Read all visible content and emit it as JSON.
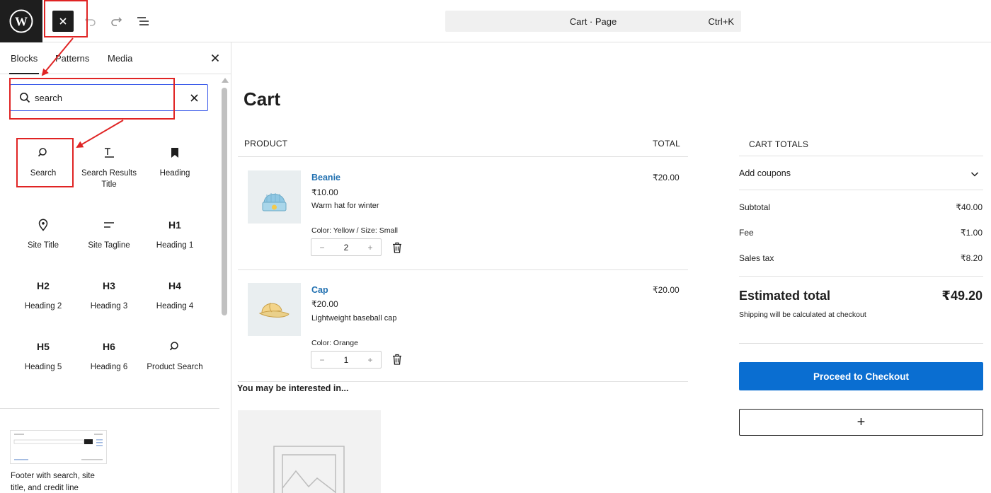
{
  "topbar": {
    "logo_icon": "wordpress-logo",
    "toggle_icon": "close-icon",
    "undo_icon": "undo-icon",
    "redo_icon": "redo-icon",
    "outline_icon": "document-overview-icon",
    "doc_title": "Cart · Page",
    "shortcut": "Ctrl+K"
  },
  "inserter": {
    "tabs": [
      "Blocks",
      "Patterns",
      "Media"
    ],
    "active_tab": "Blocks",
    "search": {
      "value": "search",
      "placeholder": "Search"
    },
    "blocks": [
      {
        "label": "Search",
        "icon": "search-icon"
      },
      {
        "label": "Search Results Title",
        "icon": "title-icon"
      },
      {
        "label": "Heading",
        "icon": "bookmark-icon"
      },
      {
        "label": "Site Title",
        "icon": "map-marker-icon"
      },
      {
        "label": "Site Tagline",
        "icon": "tagline-icon"
      },
      {
        "label": "Heading 1",
        "glyph": "H1"
      },
      {
        "label": "Heading 2",
        "glyph": "H2"
      },
      {
        "label": "Heading 3",
        "glyph": "H3"
      },
      {
        "label": "Heading 4",
        "glyph": "H4"
      },
      {
        "label": "Heading 5",
        "glyph": "H5"
      },
      {
        "label": "Heading 6",
        "glyph": "H6"
      },
      {
        "label": "Product Search",
        "icon": "search-icon"
      }
    ],
    "pattern": {
      "label": "Footer with search, site title, and credit line"
    }
  },
  "cart": {
    "title": "Cart",
    "col_product": "PRODUCT",
    "col_total": "TOTAL",
    "items": [
      {
        "name": "Beanie",
        "price": "₹10.00",
        "desc": "Warm hat for winter",
        "meta": "Color: Yellow / Size: Small",
        "qty": "2",
        "total": "₹20.00"
      },
      {
        "name": "Cap",
        "price": "₹20.00",
        "desc": "Lightweight baseball cap",
        "meta": "Color: Orange",
        "qty": "1",
        "total": "₹20.00"
      }
    ],
    "qty_minus": "−",
    "qty_plus": "+",
    "interested": "You may be interested in..."
  },
  "totals": {
    "title": "CART TOTALS",
    "coupons": "Add coupons",
    "rows": [
      {
        "label": "Subtotal",
        "value": "₹40.00"
      },
      {
        "label": "Fee",
        "value": "₹1.00"
      },
      {
        "label": "Sales tax",
        "value": "₹8.20"
      }
    ],
    "estimated_label": "Estimated total",
    "estimated_value": "₹49.20",
    "shipping_note": "Shipping will be calculated at checkout",
    "checkout_label": "Proceed to Checkout",
    "add_label": "+"
  },
  "colors": {
    "annotation": "#e02424",
    "accent_blue": "#0a6ed1",
    "link_blue": "#2271b1",
    "focus_blue": "#3858e9",
    "dark": "#1e1e1e"
  }
}
